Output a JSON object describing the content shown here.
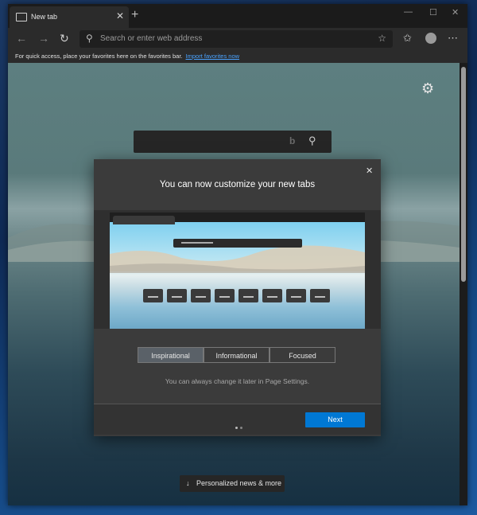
{
  "browser": {
    "tab_title": "New tab",
    "tab_close_glyph": "✕",
    "new_tab_glyph": "+",
    "minimize_glyph": "—",
    "maximize_glyph": "☐",
    "close_glyph": "✕",
    "address_placeholder": "Search or enter web address",
    "favorites_message": "For quick access, place your favorites here on the favorites bar.",
    "favorites_link": "Import favorites now",
    "icons": [
      "back-icon",
      "forward-icon",
      "refresh-icon",
      "search-icon",
      "favorite-star-icon",
      "favorites-icon",
      "profile-icon",
      "more-icon"
    ]
  },
  "newtab": {
    "settings_icon": "gear-icon",
    "search_icons": [
      "bing-icon",
      "search-icon"
    ],
    "news_label": "Personalized news & more"
  },
  "modal": {
    "title": "You can now customize your new tabs",
    "close_glyph": "✕",
    "options": [
      "Inspirational",
      "Informational",
      "Focused"
    ],
    "selected_option": "Inspirational",
    "hint": "You can always change it later in Page Settings.",
    "next_label": "Next",
    "page_dots": 2
  },
  "colors": {
    "accent": "#0078d4",
    "link": "#4aa3ff"
  }
}
